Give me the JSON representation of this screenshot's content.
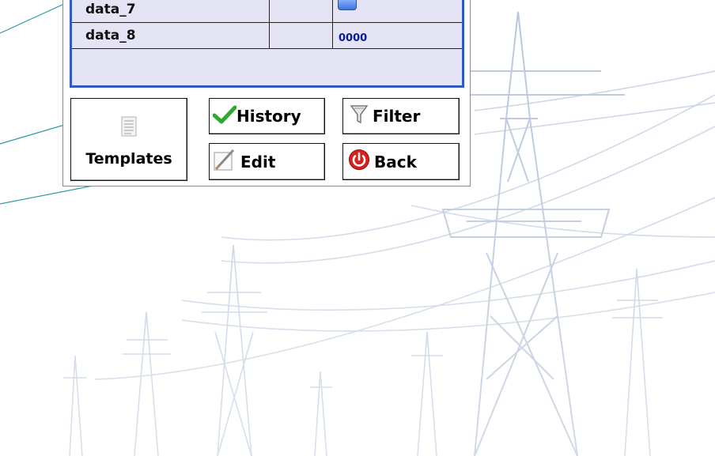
{
  "table": {
    "rows": [
      {
        "name": "data_7",
        "type": "",
        "value": ""
      },
      {
        "name": "data_8",
        "type": "",
        "value": "0000"
      }
    ]
  },
  "buttons": {
    "templates": "Templates",
    "history": "History",
    "edit": "Edit",
    "filter": "Filter",
    "back": "Back"
  },
  "icons": {
    "templates": "document-icon",
    "history": "checkmark-icon",
    "edit": "pencil-icon",
    "filter": "funnel-icon",
    "back": "power-icon",
    "data_7_value": "battery-indicator-icon"
  },
  "colors": {
    "grid_border": "#2f58c8",
    "grid_background": "#e4e4f4",
    "value_text": "#0b1a9a",
    "callout_line": "#2a9aa8",
    "back_icon": "#d8201c",
    "history_check": "#2ea82e"
  }
}
